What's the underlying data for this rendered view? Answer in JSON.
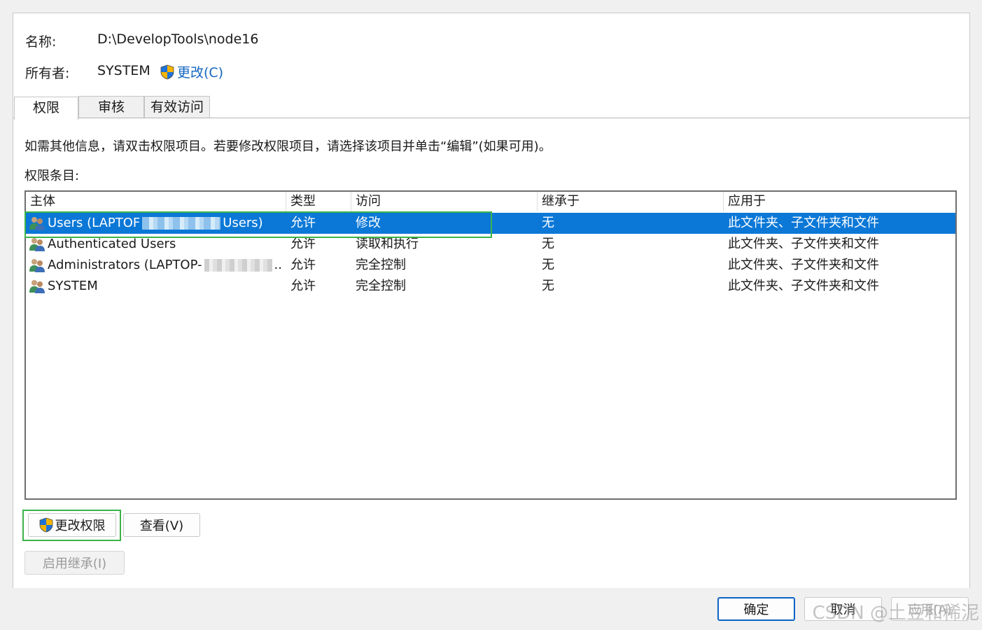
{
  "header": {
    "name_label": "名称:",
    "name_value": "D:\\DevelopTools\\node16",
    "owner_label": "所有者:",
    "owner_value": "SYSTEM",
    "change_owner_link": "更改(C)"
  },
  "tabs": [
    {
      "label": "权限",
      "active": true
    },
    {
      "label": "审核",
      "active": false
    },
    {
      "label": "有效访问",
      "active": false
    }
  ],
  "info_text": "如需其他信息，请双击权限项目。若要修改权限项目，请选择该项目并单击“编辑”(如果可用)。",
  "entries_label": "权限条目:",
  "columns": [
    "主体",
    "类型",
    "访问",
    "继承于",
    "应用于"
  ],
  "rows": [
    {
      "principal_prefix": "Users (LAPTOF",
      "principal_suffix": "Users)",
      "type": "允许",
      "access": "修改",
      "inherited_from": "无",
      "applies_to": "此文件夹、子文件夹和文件",
      "selected": true
    },
    {
      "principal_prefix": "Authenticated Users",
      "principal_suffix": "",
      "type": "允许",
      "access": "读取和执行",
      "inherited_from": "无",
      "applies_to": "此文件夹、子文件夹和文件",
      "selected": false
    },
    {
      "principal_prefix": "Administrators (LAPTOP-",
      "principal_suffix": "..",
      "type": "允许",
      "access": "完全控制",
      "inherited_from": "无",
      "applies_to": "此文件夹、子文件夹和文件",
      "selected": false
    },
    {
      "principal_prefix": "SYSTEM",
      "principal_suffix": "",
      "type": "允许",
      "access": "完全控制",
      "inherited_from": "无",
      "applies_to": "此文件夹、子文件夹和文件",
      "selected": false
    }
  ],
  "buttons": {
    "change_permissions": "更改权限",
    "view": "查看(V)",
    "enable_inheritance": "启用继承(I)",
    "ok": "确定",
    "cancel": "取消",
    "apply": "应用(A)"
  },
  "watermark": "CSDN @土豆和稀泥",
  "colors": {
    "selection": "#0b78d7",
    "highlight_box": "#3cb34a",
    "link": "#1565c0"
  },
  "icons": {
    "shield": "uac-shield-icon",
    "user_group": "user-group-icon"
  }
}
